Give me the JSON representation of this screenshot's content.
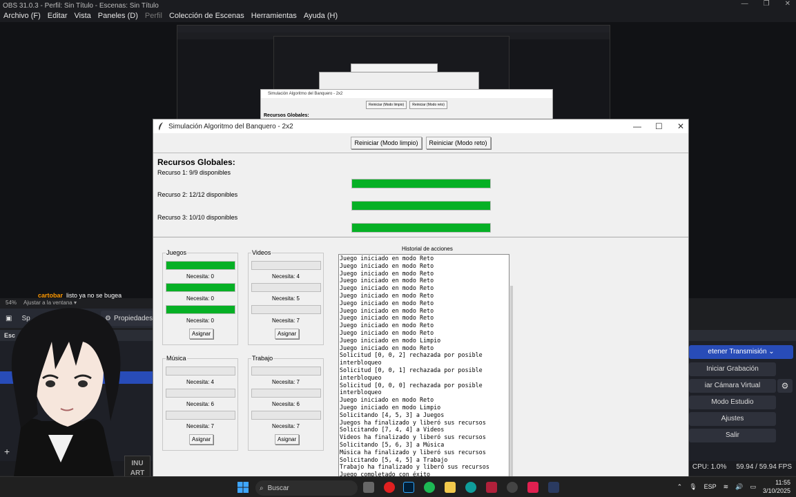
{
  "obs": {
    "title": "OBS 31.0.3 - Perfil: Sin Título - Escenas: Sin Título",
    "menu": [
      "Archivo (F)",
      "Editar",
      "Vista",
      "Paneles (D)",
      "Perfil",
      "Colección de Escenas",
      "Herramientas",
      "Ayuda (H)"
    ],
    "zoom": "54%",
    "fit": "Ajustar a la ventana",
    "chat_user": "cartobar",
    "chat_msg": "listo ya no se bugea",
    "scenes_label": "Esc",
    "properties": "Propiedades",
    "sources_prefix": "Sp",
    "controls": {
      "stream": "etener Transmisión",
      "record": "Iniciar Grabación",
      "vcam": "iar Cámara Virtual",
      "studio": "Modo Estudio",
      "settings": "Ajustes",
      "exit": "Salir"
    },
    "status": {
      "cpu": "CPU: 1.0%",
      "fps": "59.94 / 59.94 FPS"
    },
    "watermark": [
      "INU",
      "ART"
    ]
  },
  "nested": {
    "title": "Simulación Algoritmo del Banquero - 2x2",
    "btn1": "Reiniciar (Modo limpio)",
    "btn2": "Reiniciar (Modo reto)",
    "rg": "Recursos Globales:"
  },
  "app": {
    "title": "Simulación Algoritmo del Banquero - 2x2",
    "btn_clean": "Reiniciar (Modo limpio)",
    "btn_challenge": "Reiniciar (Modo reto)",
    "globals_title": "Recursos Globales:",
    "resources": [
      {
        "label": "Recurso 1: 9/9 disponibles",
        "fill": 1.0
      },
      {
        "label": "Recurso 2: 12/12 disponibles",
        "fill": 1.0
      },
      {
        "label": "Recurso 3: 10/10 disponibles",
        "fill": 1.0
      }
    ],
    "assign": "Asignar",
    "groups": [
      {
        "name": "Juegos",
        "needs": [
          "Necesita: 0",
          "Necesita: 0",
          "Necesita: 0"
        ],
        "fills": [
          1,
          1,
          1
        ]
      },
      {
        "name": "Videos",
        "needs": [
          "Necesita: 4",
          "Necesita: 5",
          "Necesita: 7"
        ],
        "fills": [
          0,
          0,
          0
        ]
      },
      {
        "name": "Música",
        "needs": [
          "Necesita: 4",
          "Necesita: 6",
          "Necesita: 7"
        ],
        "fills": [
          0,
          0,
          0
        ]
      },
      {
        "name": "Trabajo",
        "needs": [
          "Necesita: 7",
          "Necesita: 6",
          "Necesita: 7"
        ],
        "fills": [
          0,
          0,
          0
        ]
      }
    ],
    "history_title": "Historial de acciones",
    "history": [
      "Juego iniciado en modo Reto",
      "Juego iniciado en modo Reto",
      "Juego iniciado en modo Reto",
      "Juego iniciado en modo Reto",
      "Juego iniciado en modo Reto",
      "Juego iniciado en modo Reto",
      "Juego iniciado en modo Reto",
      "Juego iniciado en modo Reto",
      "Juego iniciado en modo Reto",
      "Juego iniciado en modo Reto",
      "Juego iniciado en modo Reto",
      "Juego iniciado en modo Limpio",
      "Juego iniciado en modo Reto",
      "Solicitud [0, 0, 2] rechazada por posible",
      "interbloqueo",
      "Solicitud [0, 0, 1] rechazada por posible",
      "interbloqueo",
      "Solicitud [0, 0, 0] rechazada por posible",
      "interbloqueo",
      "Juego iniciado en modo Reto",
      "Juego iniciado en modo Limpio",
      "Solicitando [4, 5, 3] a Juegos",
      "Juegos ha finalizado y liberó sus recursos",
      "Solicitando [7, 4, 4] a Videos",
      "Videos ha finalizado y liberó sus recursos",
      "Solicitando [5, 6, 3] a Música",
      "Música ha finalizado y liberó sus recursos",
      "Solicitando [5, 4, 5] a Trabajo",
      "Trabajo ha finalizado y liberó sus recursos",
      "Juego completado con éxito"
    ]
  },
  "taskbar": {
    "search": "Buscar",
    "lang": "ESP",
    "time": "11:55",
    "date": "3/10/2025"
  }
}
